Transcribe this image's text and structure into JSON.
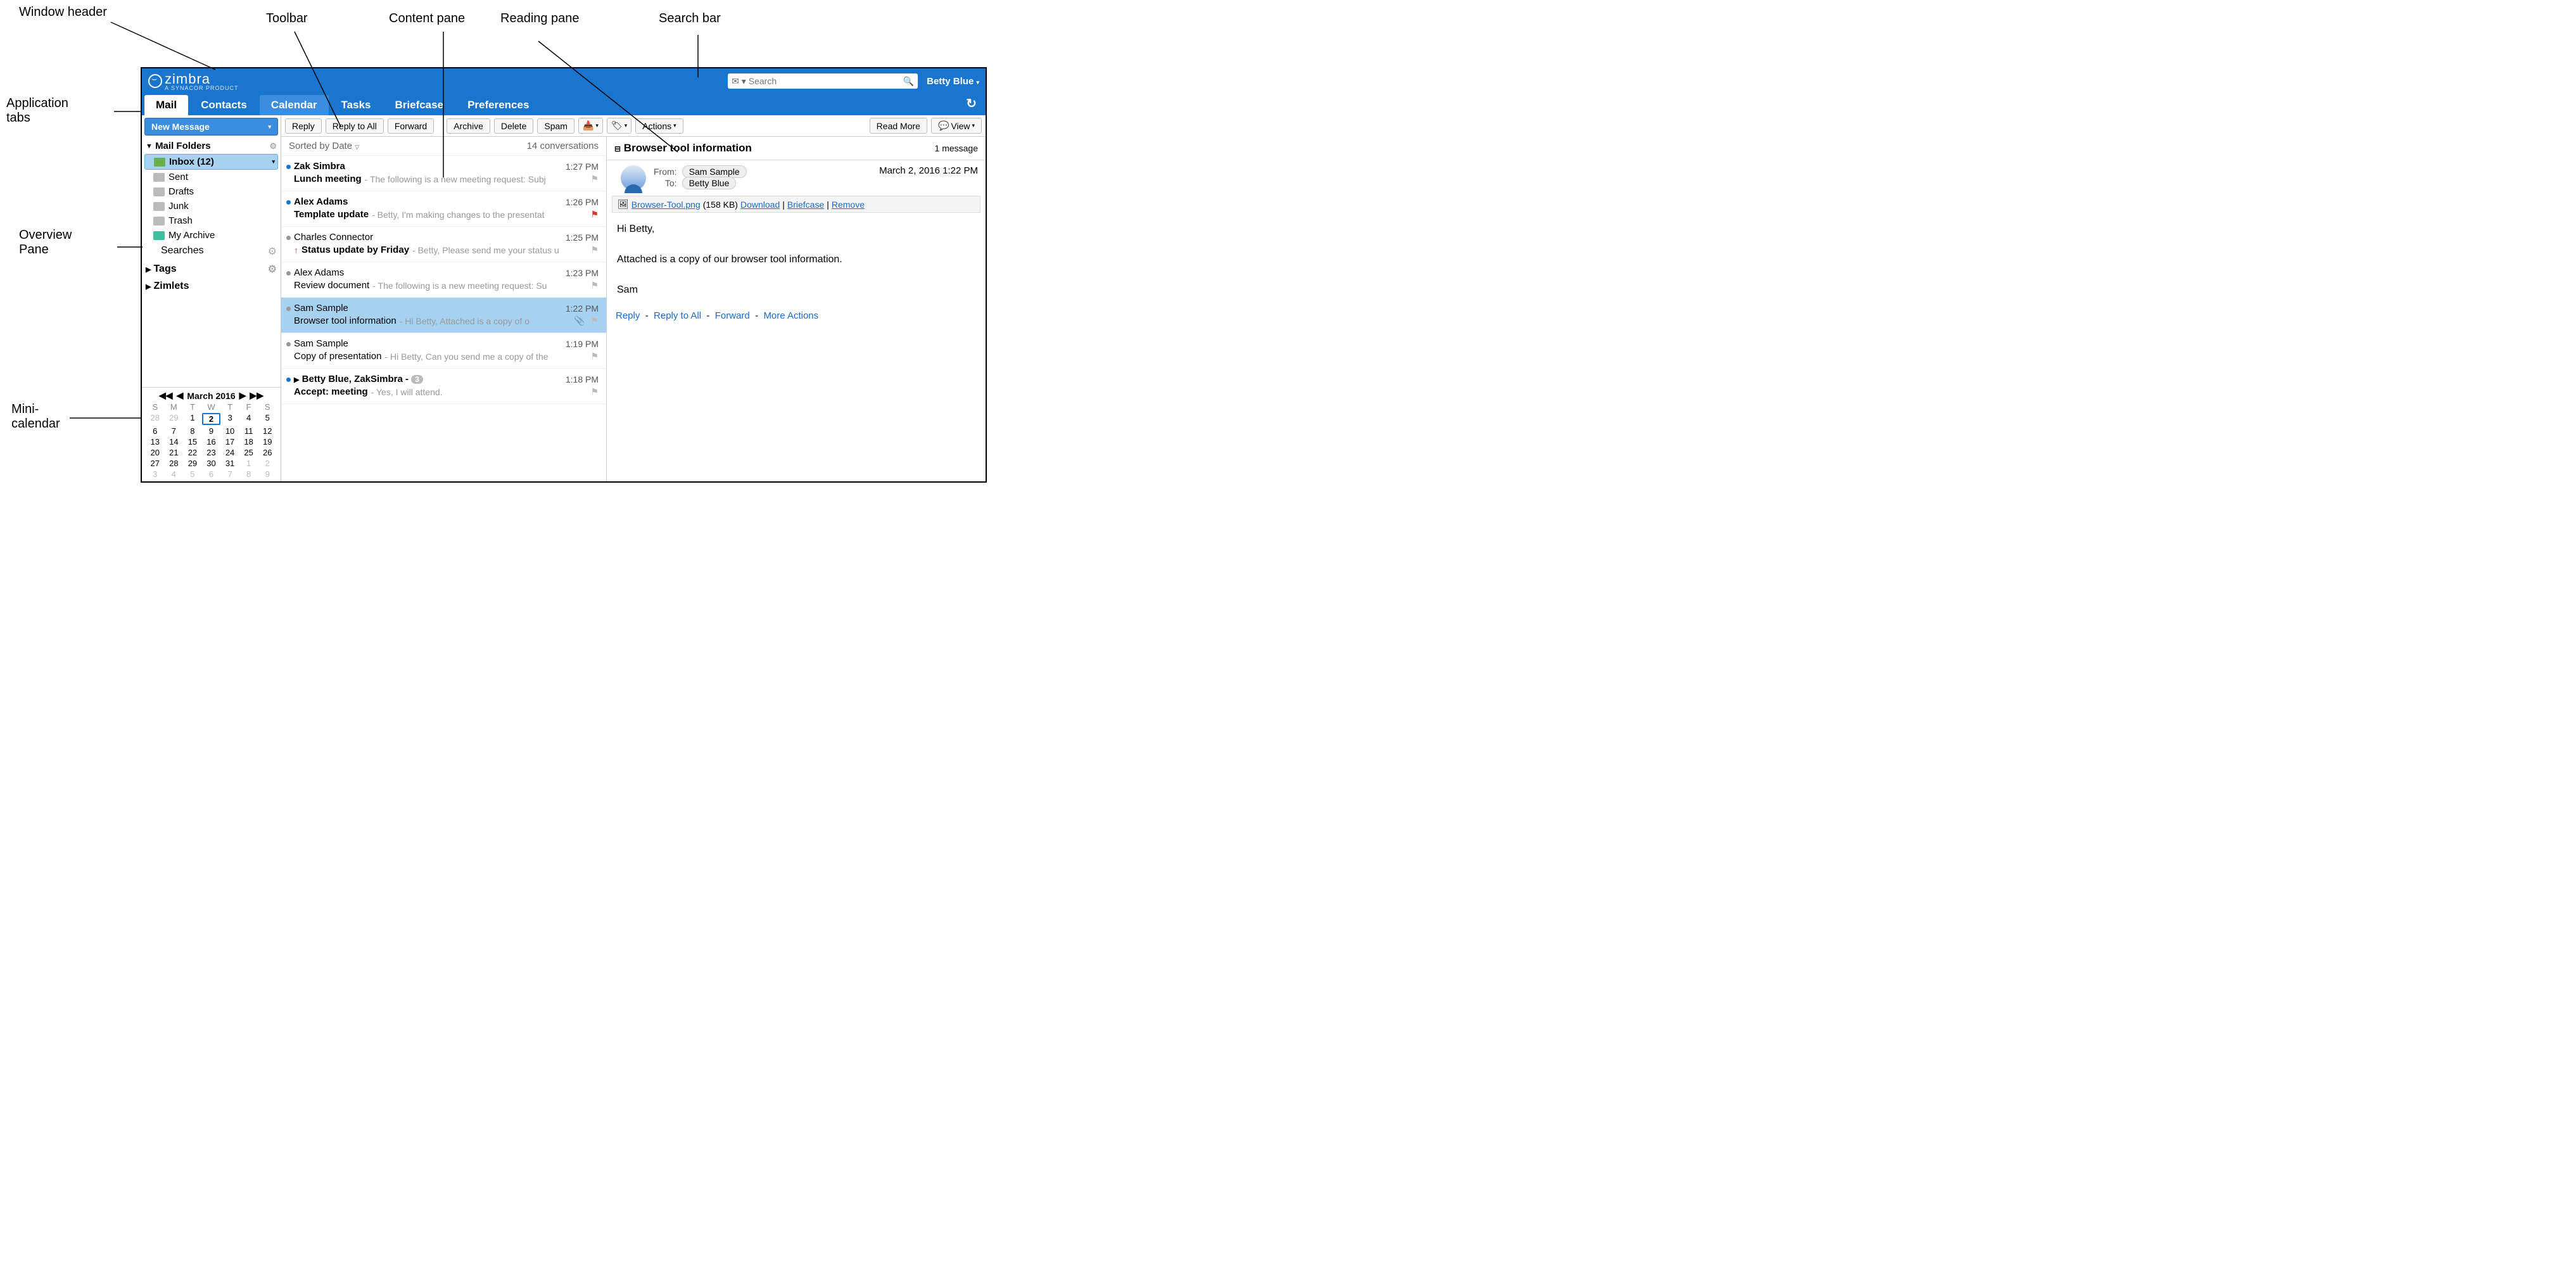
{
  "callouts": {
    "window_header": "Window header",
    "toolbar": "Toolbar",
    "content_pane": "Content pane",
    "reading_pane": "Reading pane",
    "search_bar": "Search bar",
    "app_tabs_l1": "Application",
    "app_tabs_l2": "tabs",
    "overview_l1": "Overview",
    "overview_l2": "Pane",
    "mini_cal_l1": "Mini-",
    "mini_cal_l2": "calendar"
  },
  "header": {
    "brand": "zimbra",
    "brand_sub": "A SYNACOR PRODUCT",
    "search_placeholder": "Search",
    "user_name": "Betty Blue"
  },
  "tabs": [
    "Mail",
    "Contacts",
    "Calendar",
    "Tasks",
    "Briefcase",
    "Preferences"
  ],
  "sidebar": {
    "new_message": "New Message",
    "mail_folders_label": "Mail Folders",
    "folders": {
      "inbox": "Inbox (12)",
      "sent": "Sent",
      "drafts": "Drafts",
      "junk": "Junk",
      "trash": "Trash",
      "archive": "My Archive"
    },
    "searches_label": "Searches",
    "tags_label": "Tags",
    "zimlets_label": "Zimlets"
  },
  "mini_cal": {
    "title": "March 2016",
    "dow": [
      "S",
      "M",
      "T",
      "W",
      "T",
      "F",
      "S"
    ],
    "weeks": [
      [
        "28",
        "29",
        "1",
        "2",
        "3",
        "4",
        "5"
      ],
      [
        "6",
        "7",
        "8",
        "9",
        "10",
        "11",
        "12"
      ],
      [
        "13",
        "14",
        "15",
        "16",
        "17",
        "18",
        "19"
      ],
      [
        "20",
        "21",
        "22",
        "23",
        "24",
        "25",
        "26"
      ],
      [
        "27",
        "28",
        "29",
        "30",
        "31",
        "1",
        "2"
      ],
      [
        "3",
        "4",
        "5",
        "6",
        "7",
        "8",
        "9"
      ]
    ],
    "today": "2"
  },
  "toolbar": {
    "reply": "Reply",
    "reply_all": "Reply to All",
    "forward": "Forward",
    "archive": "Archive",
    "delete": "Delete",
    "spam": "Spam",
    "actions": "Actions",
    "read_more": "Read More",
    "view": "View"
  },
  "content": {
    "sort_label": "Sorted by Date",
    "count_label": "14 conversations"
  },
  "messages": [
    {
      "from": "Zak Simbra",
      "time": "1:27 PM",
      "subject": "Lunch meeting",
      "snippet": " - The following is a new meeting request: Subj",
      "unread": true,
      "dot": "blue",
      "flag": "gray"
    },
    {
      "from": "Alex Adams",
      "time": "1:26 PM",
      "subject": "Template update",
      "snippet": " - Betty, I'm making changes to the presentat",
      "unread": true,
      "dot": "blue",
      "flag": "red"
    },
    {
      "from": "Charles Connector",
      "time": "1:25 PM",
      "subject": "Status update by Friday",
      "snippet": " - Betty, Please send me your status u",
      "unread": false,
      "dot": "gray",
      "flag": "gray",
      "high_prio": true,
      "subject_bold": true
    },
    {
      "from": "Alex Adams",
      "time": "1:23 PM",
      "subject": "Review document",
      "snippet": " - The following is a new meeting request: Su",
      "unread": false,
      "dot": "gray",
      "flag": "gray"
    },
    {
      "from": "Sam Sample",
      "time": "1:22 PM",
      "subject": "Browser tool information",
      "snippet": " - Hi Betty, Attached is a copy of o",
      "unread": false,
      "dot": "gray",
      "flag": "gray",
      "selected": true,
      "clip": true
    },
    {
      "from": "Sam Sample",
      "time": "1:19 PM",
      "subject": "Copy of presentation",
      "snippet": " - Hi Betty, Can you send me a copy of the",
      "unread": false,
      "dot": "gray",
      "flag": "gray"
    },
    {
      "from": "Betty Blue, ZakSimbra",
      "time": "1:18 PM",
      "subject": "Accept: meeting",
      "snippet": " - Yes, I will attend.",
      "unread": true,
      "dot": "blue",
      "flag": "gray",
      "expand": true,
      "badge": "3",
      "from_suffix": " -"
    }
  ],
  "reading": {
    "subject": "Browser tool information",
    "count": "1 message",
    "from_label": "From:",
    "from_value": "Sam Sample",
    "to_label": "To:",
    "to_value": "Betty Blue",
    "date": "March 2, 2016 1:22 PM",
    "attachment_name": "Browser-Tool.png",
    "attachment_size": "(158 KB)",
    "download": "Download",
    "briefcase": "Briefcase",
    "remove": "Remove",
    "body_l1": "Hi Betty,",
    "body_l2": "Attached is a copy of our browser tool information.",
    "body_l3": "Sam",
    "act_reply": "Reply",
    "act_reply_all": "Reply to All",
    "act_forward": "Forward",
    "act_more": "More Actions"
  }
}
